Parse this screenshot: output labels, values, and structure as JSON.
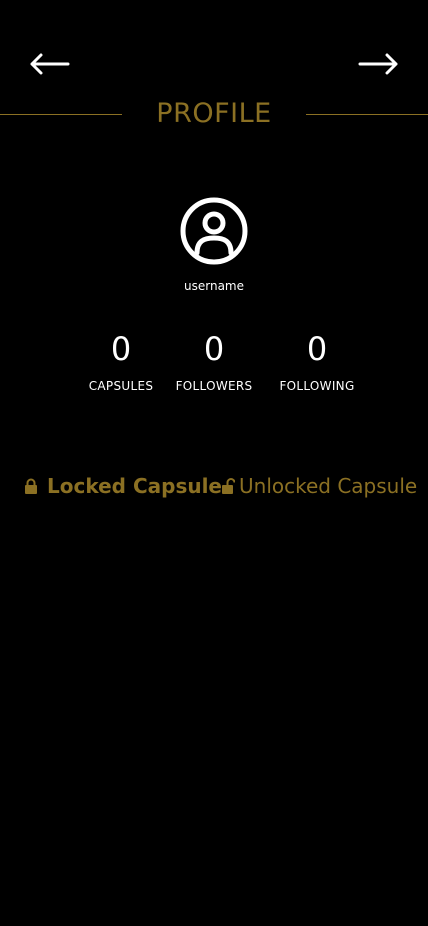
{
  "header": {
    "back_icon": "arrow-left-icon",
    "forward_icon": "arrow-right-icon",
    "title": "PROFILE"
  },
  "profile": {
    "avatar_icon": "user-circle-icon",
    "username": "username"
  },
  "stats": [
    {
      "value": "0",
      "label": "CAPSULES"
    },
    {
      "value": "0",
      "label": "FOLLOWERS"
    },
    {
      "value": "0",
      "label": "FOLLOWING"
    }
  ],
  "tabs": {
    "locked": {
      "label": "Locked Capsule",
      "icon": "lock-icon",
      "selected": true
    },
    "unlocked": {
      "label": "Unlocked Capsule",
      "icon": "unlock-icon",
      "selected": false
    }
  },
  "colors": {
    "background": "#000000",
    "accent": "#8b7023",
    "text": "#ffffff"
  }
}
